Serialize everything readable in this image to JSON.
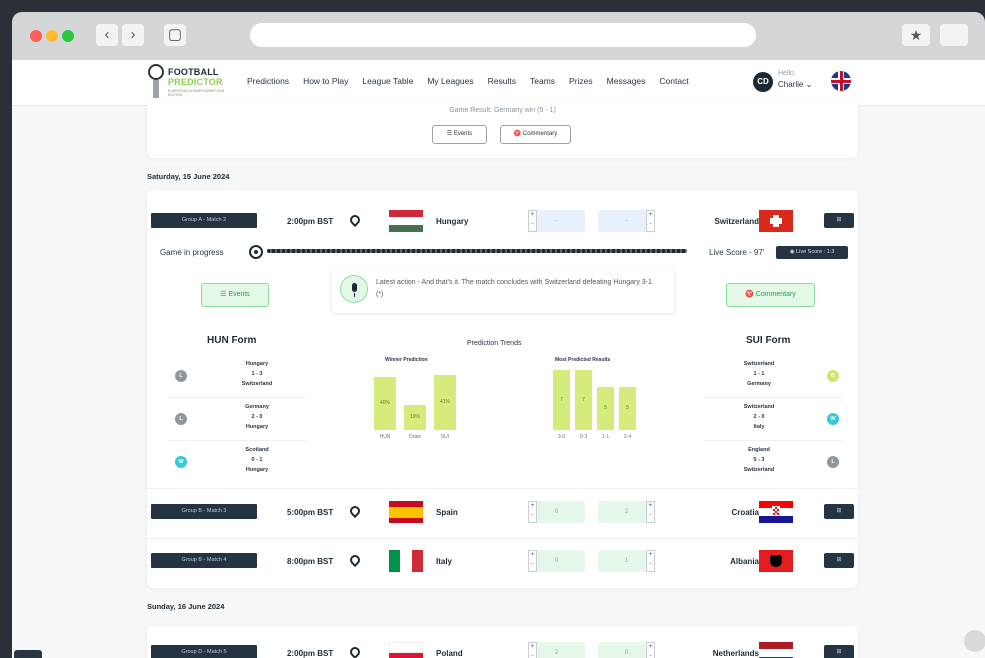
{
  "site": {
    "logo_line1": "FOOTBALL",
    "logo_line2": "PREDICTOR",
    "logo_tagline": "EUROPEAN CHAMPIONSHIP 2024 EDITION"
  },
  "menu": [
    "Predictions",
    "How to Play",
    "League Table",
    "My Leagues",
    "Results",
    "Teams",
    "Prizes",
    "Messages",
    "Contact"
  ],
  "user": {
    "initials": "CD",
    "greeting": "Hello,",
    "name": "Charlie ⌄"
  },
  "previous_match": {
    "result": "Game Result: Germany win (5 - 1)",
    "events_label": "☰ Events",
    "commentary_label": "♈ Commentary"
  },
  "dates": [
    "Saturday, 15 June 2024",
    "Sunday, 16 June 2024"
  ],
  "matches": [
    {
      "group": "Group A - Match 2",
      "time": "2:00pm BST",
      "home": "Hungary",
      "away": "Switzerland",
      "home_pred": "-",
      "away_pred": "-",
      "h2h": "⊞"
    },
    {
      "group": "Group B - Match 3",
      "time": "5:00pm BST",
      "home": "Spain",
      "away": "Croatia",
      "home_pred": "0",
      "away_pred": "2",
      "h2h": "⊞"
    },
    {
      "group": "Group B - Match 4",
      "time": "8:00pm BST",
      "home": "Italy",
      "away": "Albania",
      "home_pred": "0",
      "away_pred": "1",
      "h2h": "⊞"
    },
    {
      "group": "Group D - Match 5",
      "time": "2:00pm BST",
      "home": "Poland",
      "away": "Netherlands",
      "home_pred": "2",
      "away_pred": "0",
      "h2h": "⊞"
    }
  ],
  "live": {
    "status": "Game in progress",
    "live_score_label": "Live Score - 97'",
    "live_score_badge": "◉ Live Score : 1:3",
    "events_label": "☰ Events",
    "commentary_label": "♈ Commentary",
    "latest_action": "Latest action - And that's it. The match concludes with Switzerland defeating Hungary 3-1. (*)"
  },
  "home_form": {
    "title": "HUN Form",
    "items": [
      {
        "result": "L",
        "team1": "Hungary",
        "score": "1 - 3",
        "team2": "Switzerland"
      },
      {
        "result": "L",
        "team1": "Germany",
        "score": "2 - 0",
        "team2": "Hungary"
      },
      {
        "result": "W",
        "team1": "Scotland",
        "score": "0 - 1",
        "team2": "Hungary"
      }
    ]
  },
  "away_form": {
    "title": "SUI Form",
    "items": [
      {
        "result": "D",
        "team1": "Switzerland",
        "score": "1 - 1",
        "team2": "Germany"
      },
      {
        "result": "W",
        "team1": "Switzerland",
        "score": "2 - 0",
        "team2": "Italy"
      },
      {
        "result": "L",
        "team1": "England",
        "score": "5 - 3",
        "team2": "Switzerland"
      }
    ]
  },
  "trends": {
    "title": "Prediction Trends",
    "winner_title": "Winner Prediction",
    "results_title": "Most Predicted Results"
  },
  "colors": {
    "accent": "#8ccf4d",
    "dark": "#243443",
    "win": "#35c8d8",
    "loss": "#8e979d",
    "draw": "#c9e86f"
  },
  "chart_data": [
    {
      "type": "bar",
      "title": "Winner Prediction",
      "categories": [
        "HUN",
        "Draw",
        "SUI"
      ],
      "values": [
        40,
        19,
        41
      ],
      "labels": [
        "40%",
        "19%",
        "41%"
      ]
    },
    {
      "type": "bar",
      "title": "Most Predicted Results",
      "categories": [
        "3-0",
        "0-3",
        "1-1",
        "2-4"
      ],
      "values": [
        7,
        7,
        5,
        5
      ]
    }
  ]
}
